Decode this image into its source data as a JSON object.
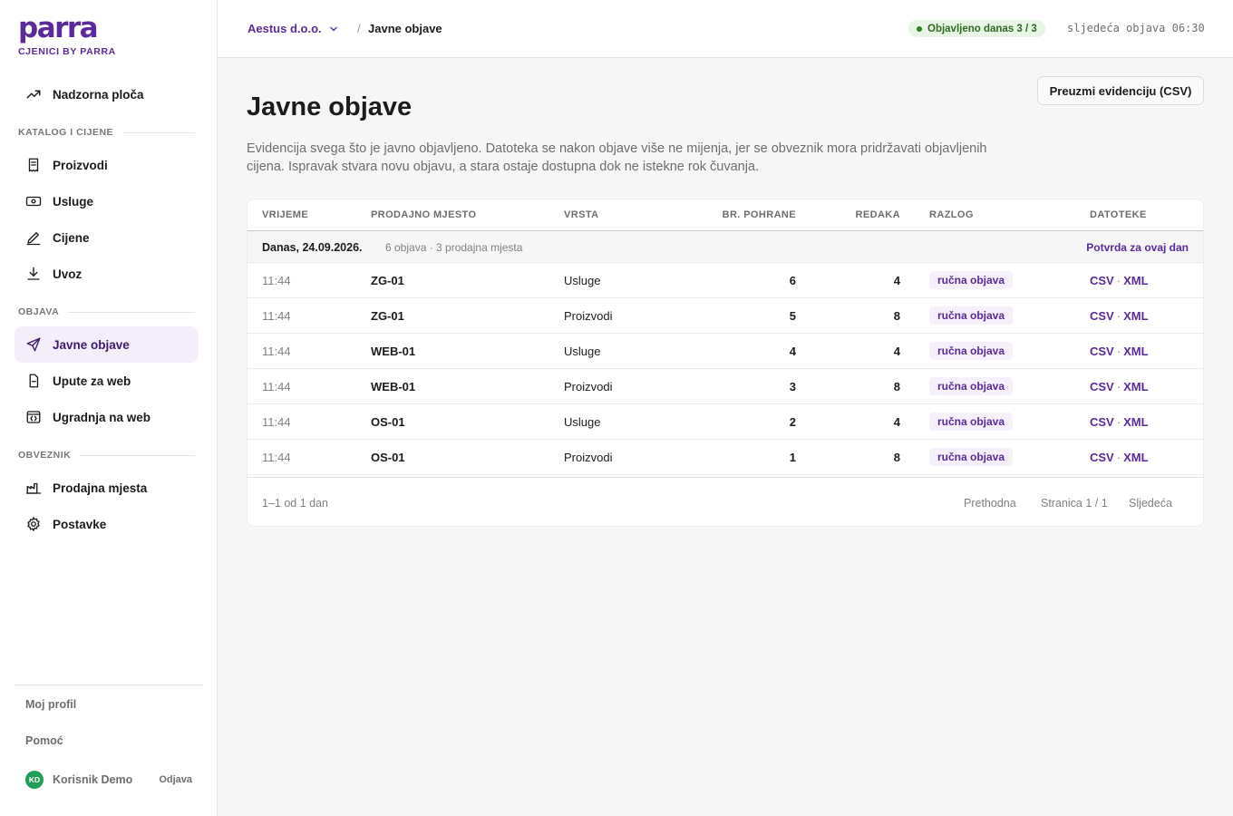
{
  "brand": {
    "name": "parra",
    "tagline": "CJENICI BY PARRA",
    "color": "#5b2a9b"
  },
  "sidebar": {
    "top_item": {
      "label": "Nadzorna ploča",
      "icon": "trend-icon"
    },
    "sections": [
      {
        "title": "KATALOG I CIJENE",
        "items": [
          {
            "label": "Proizvodi",
            "icon": "receipt-icon"
          },
          {
            "label": "Usluge",
            "icon": "banknote-icon"
          },
          {
            "label": "Cijene",
            "icon": "pencil-icon"
          },
          {
            "label": "Uvoz",
            "icon": "download-icon"
          }
        ]
      },
      {
        "title": "OBJAVA",
        "items": [
          {
            "label": "Javne objave",
            "icon": "send-icon",
            "active": true
          },
          {
            "label": "Upute za web",
            "icon": "document-icon"
          },
          {
            "label": "Ugradnja na web",
            "icon": "code-window-icon"
          }
        ]
      },
      {
        "title": "OBVEZNIK",
        "items": [
          {
            "label": "Prodajna mjesta",
            "icon": "factory-icon"
          },
          {
            "label": "Postavke",
            "icon": "gear-icon"
          }
        ]
      }
    ],
    "footer": {
      "profile_label": "Moj profil",
      "help_label": "Pomoć",
      "user_initials": "KD",
      "user_name": "Korisnik Demo",
      "logout_label": "Odjava"
    }
  },
  "topbar": {
    "org_name": "Aestus d.o.o.",
    "breadcrumb_separator": "/",
    "breadcrumb_current": "Javne objave",
    "published_badge": "Objavljeno danas 3 / 3",
    "next_publication": "sljedeća objava 06:30"
  },
  "page": {
    "title": "Javne objave",
    "export_button": "Preuzmi evidenciju (CSV)",
    "description": "Evidencija svega što je javno objavljeno. Datoteka se nakon objave više ne mijenja, jer se obveznik mora pridržavati objavljenih cijena. Ispravak stvara novu objavu, a stara ostaje dostupna dok ne istekne rok čuvanja."
  },
  "table": {
    "columns": [
      "VRIJEME",
      "PRODAJNO MJESTO",
      "VRSTA",
      "BR. POHRANE",
      "REDAKA",
      "RAZLOG",
      "DATOTEKE"
    ],
    "group": {
      "date": "Danas, 24.09.2026.",
      "meta": "6 objava · 3 prodajna mjesta",
      "link": "Potvrda za ovaj dan"
    },
    "file_separator": "·",
    "rows": [
      {
        "time": "11:44",
        "location": "ZG-01",
        "type": "Usluge",
        "storage": "6",
        "rows": "4",
        "reason": "ručna objava",
        "file1": "CSV",
        "file2": "XML"
      },
      {
        "time": "11:44",
        "location": "ZG-01",
        "type": "Proizvodi",
        "storage": "5",
        "rows": "8",
        "reason": "ručna objava",
        "file1": "CSV",
        "file2": "XML"
      },
      {
        "time": "11:44",
        "location": "WEB-01",
        "type": "Usluge",
        "storage": "4",
        "rows": "4",
        "reason": "ručna objava",
        "file1": "CSV",
        "file2": "XML"
      },
      {
        "time": "11:44",
        "location": "WEB-01",
        "type": "Proizvodi",
        "storage": "3",
        "rows": "8",
        "reason": "ručna objava",
        "file1": "CSV",
        "file2": "XML"
      },
      {
        "time": "11:44",
        "location": "OS-01",
        "type": "Usluge",
        "storage": "2",
        "rows": "4",
        "reason": "ručna objava",
        "file1": "CSV",
        "file2": "XML"
      },
      {
        "time": "11:44",
        "location": "OS-01",
        "type": "Proizvodi",
        "storage": "1",
        "rows": "8",
        "reason": "ručna objava",
        "file1": "CSV",
        "file2": "XML"
      }
    ],
    "footer": {
      "range": "1–1 od 1 dan",
      "prev": "Prethodna",
      "page": "Stranica 1 / 1",
      "next": "Sljedeća"
    }
  }
}
